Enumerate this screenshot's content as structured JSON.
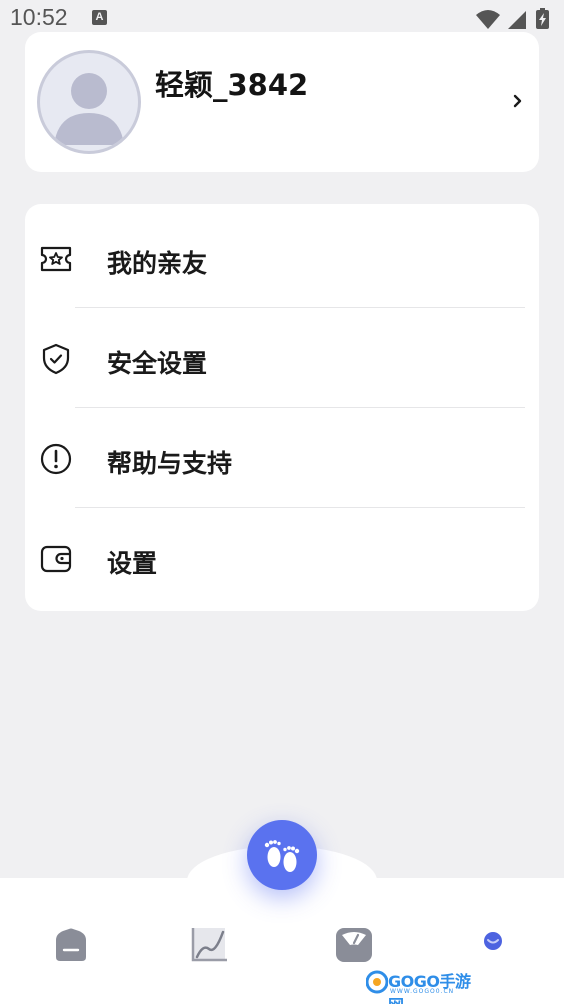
{
  "status_bar": {
    "time": "10:52",
    "notification_glyph": "A"
  },
  "profile": {
    "username": "轻颖_3842"
  },
  "menu": {
    "items": [
      {
        "label": "我的亲友",
        "icon": "ticket-star-icon"
      },
      {
        "label": "安全设置",
        "icon": "shield-check-icon"
      },
      {
        "label": "帮助与支持",
        "icon": "exclamation-circle-icon"
      },
      {
        "label": "设置",
        "icon": "wallet-icon"
      }
    ]
  },
  "bottom_nav": {
    "items": [
      {
        "icon": "home-icon"
      },
      {
        "icon": "chart-icon"
      },
      {
        "icon": "scale-icon"
      },
      {
        "icon": "profile-dot-icon",
        "active": true
      }
    ],
    "center_button_icon": "baby-feet-icon",
    "accent_color": "#5a72ef"
  },
  "watermark": {
    "text": "GOGO手游网",
    "sub": "WWW.GOGO0.CN"
  }
}
